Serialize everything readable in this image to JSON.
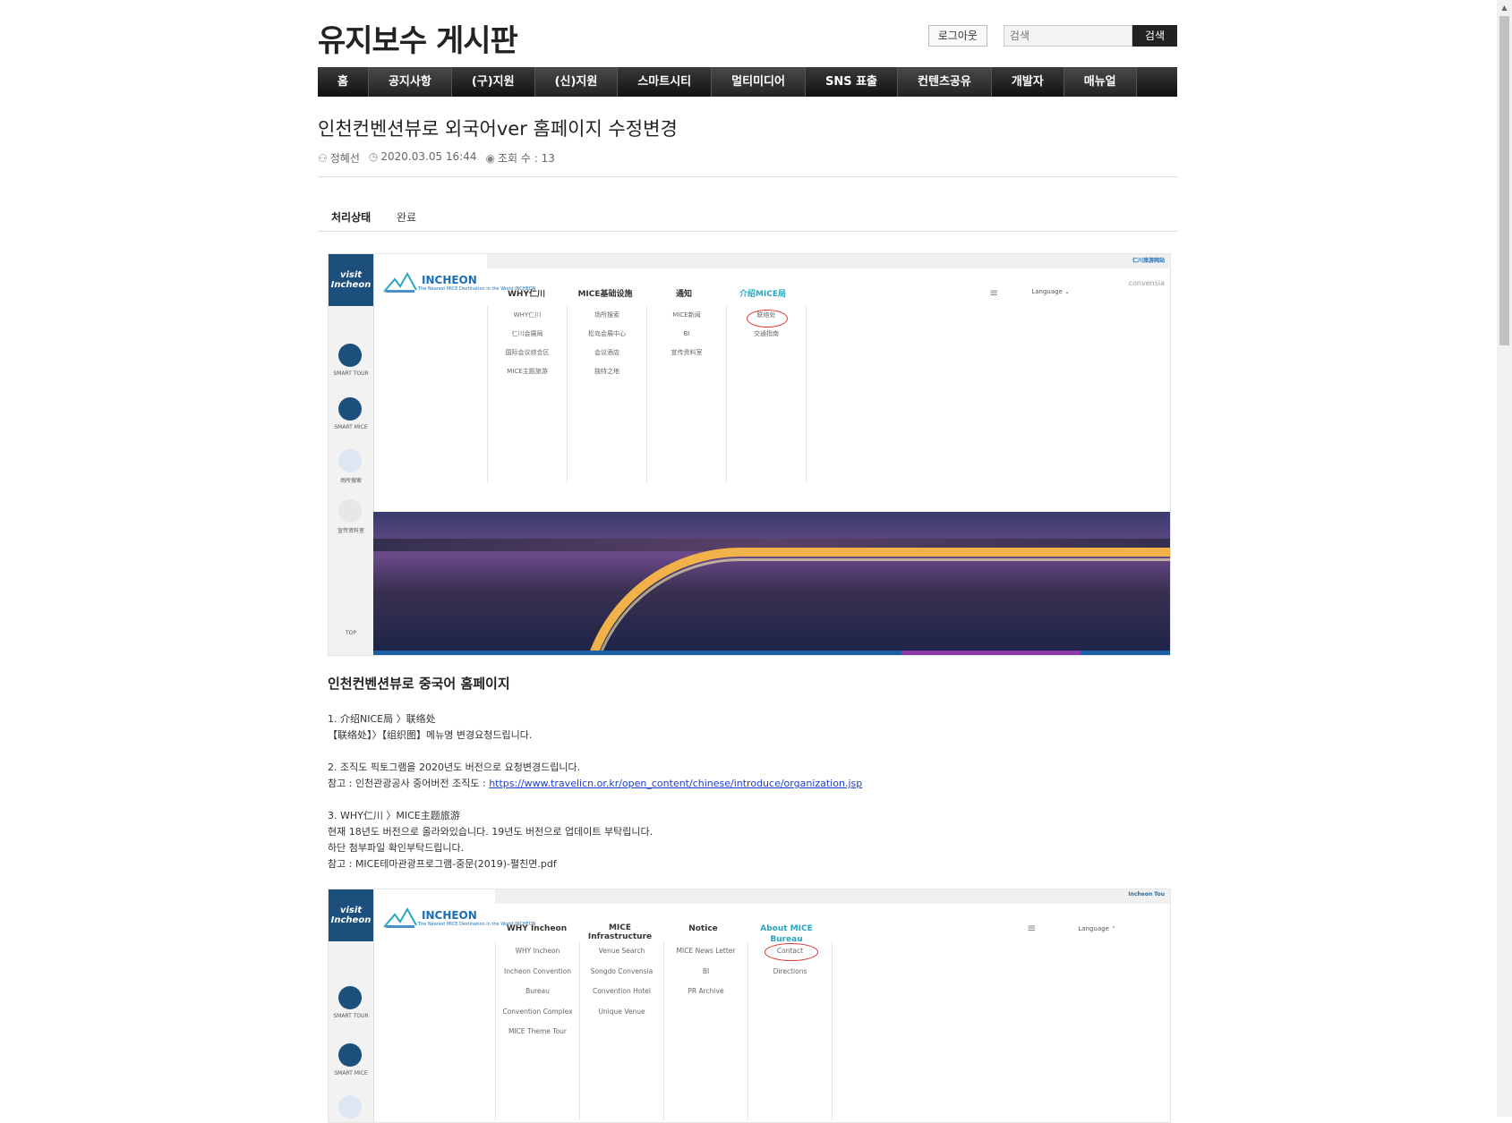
{
  "site": {
    "title": "유지보수 게시판",
    "logout_label": "로그아웃",
    "search_placeholder": "검색",
    "search_button": "검색"
  },
  "nav": [
    {
      "label": "홈"
    },
    {
      "label": "공지사항"
    },
    {
      "label": "(구)지원"
    },
    {
      "label": "(신)지원"
    },
    {
      "label": "스마트시티"
    },
    {
      "label": "멀티미디어"
    },
    {
      "label": "SNS 표출"
    },
    {
      "label": "컨텐츠공유"
    },
    {
      "label": "개발자"
    },
    {
      "label": "매뉴얼"
    }
  ],
  "post": {
    "title": "인천컨벤션뷰로 외국어ver 홈페이지 수정변경",
    "author": "정혜선",
    "datetime": "2020.03.05 16:44",
    "views": "조회 수 : 13",
    "status_label": "처리상태",
    "status_value": "완료"
  },
  "shot1": {
    "visit_logo": "visit Incheon",
    "brand": "INCHEON",
    "brand_sub": "The Nearest MICE Destination in the World INCHEON",
    "top_link": "仁川旅游网站",
    "menu": [
      "WHY仁川",
      "MICE基础设施",
      "通知",
      "介绍MICE局"
    ],
    "lang": "Language",
    "convensia": "convensia",
    "side": [
      "SMART TOUR",
      "SMART MICE",
      "场所搜索",
      "宣传资料室",
      "TOP"
    ],
    "dropdown": [
      [
        "WHY仁川",
        "仁川会展局",
        "国际会议综合区",
        "MICE主题旅游"
      ],
      [
        "场所搜索",
        "松岛会展中心",
        "会议酒店",
        "独特之地"
      ],
      [
        "MICE新闻",
        "BI",
        "宣传资料室"
      ],
      [
        "联络处",
        "交通指南"
      ]
    ]
  },
  "content": {
    "heading": "인천컨벤션뷰로 중국어 홈페이지",
    "p1a": "1. 介绍NICE局 〉联络处",
    "p1b": "【联络处】〉【组织图】메뉴명 변경요청드립니다.",
    "p2a": "2. 조직도 픽토그램을 2020년도 버전으로 요청변경드립니다.",
    "p2b_prefix": "참고 : 인천관광공사 중어버전 조직도 : ",
    "p2b_link": "https://www.travelicn.or.kr/open_content/chinese/introduce/organization.jsp",
    "p3a": "3. WHY仁川 〉MICE主题旅游",
    "p3b": "현재 18년도 버전으로 올라와있습니다. 19년도 버전으로 업데이트 부탁립니다.",
    "p3c": "하단 첨부파일 확인부탁드립니다.",
    "p3d": "참고 : MICE테마관광프로그램-중문(2019)-펼친면.pdf"
  },
  "shot2": {
    "visit_logo": "visit Incheon",
    "brand": "INCHEON",
    "brand_sub": "The Nearest MICE Destination in the World INCHEON",
    "top_link": "Incheon Tou",
    "menu": [
      "WHY Incheon",
      "MICE Infrastructure",
      "Notice",
      "About MICE Bureau"
    ],
    "lang": "Language",
    "side": [
      "SMART TOUR",
      "SMART MICE"
    ],
    "dropdown": [
      [
        "WHY Incheon",
        "Incheon Convention",
        "Bureau",
        "Convention Complex",
        "MICE Theme Tour"
      ],
      [
        "Venue Search",
        "Songdo Convensia",
        "Convention Hotel",
        "Unique Venue"
      ],
      [
        "MICE News Letter",
        "BI",
        "PR Archive"
      ],
      [
        "Contact",
        "Directions"
      ]
    ]
  }
}
